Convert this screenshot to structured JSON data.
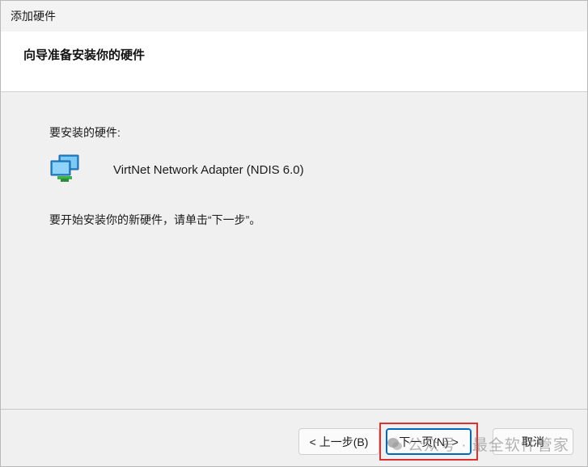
{
  "window": {
    "title": "添加硬件"
  },
  "header": {
    "title": "向导准备安装你的硬件"
  },
  "content": {
    "hardware_label": "要安装的硬件:",
    "device_icon": "network-adapter-icon",
    "device_name": "VirtNet Network Adapter (NDIS 6.0)",
    "instruction": "要开始安装你的新硬件，请单击“下一步”。"
  },
  "footer": {
    "back_label": "< 上一步(B)",
    "next_label": "下一页(N) >",
    "cancel_label": "取消"
  },
  "overlay": {
    "watermark_text": "公众号 · 最全软件管家",
    "highlight_color": "#e0302e"
  }
}
